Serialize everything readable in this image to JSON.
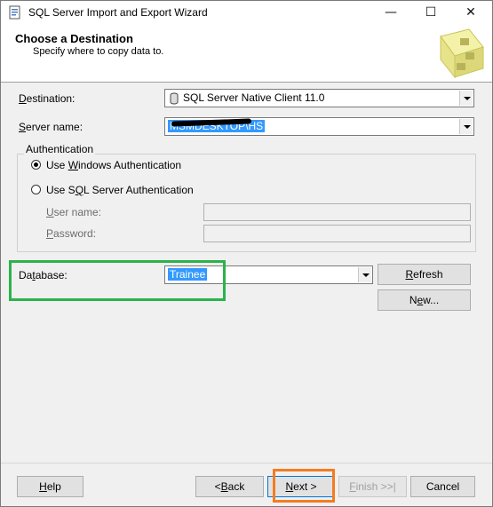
{
  "window": {
    "title": "SQL Server Import and Export Wizard",
    "controls": {
      "minimize": "—",
      "maximize": "☐",
      "close": "✕"
    }
  },
  "header": {
    "title": "Choose a Destination",
    "subtitle": "Specify where to copy data to."
  },
  "form": {
    "destination": {
      "label_pre": "",
      "label_u": "D",
      "label_post": "estination:",
      "value": "SQL Server Native Client 11.0"
    },
    "server_name": {
      "label_pre": "",
      "label_u": "S",
      "label_post": "erver name:",
      "value": "MSMDESKTOP\\HS"
    },
    "authentication": {
      "title": "Authentication",
      "windows": {
        "label_pre": "Use ",
        "label_u": "W",
        "label_post": "indows Authentication",
        "selected": true
      },
      "sql": {
        "label_pre": "Use S",
        "label_u": "Q",
        "label_post": "L Server Authentication",
        "selected": false
      },
      "user_name": {
        "label_pre": "",
        "label_u": "U",
        "label_post": "ser name:",
        "value": ""
      },
      "password": {
        "label_pre": "",
        "label_u": "P",
        "label_post": "assword:",
        "value": ""
      }
    },
    "database": {
      "label_pre": "Da",
      "label_u": "t",
      "label_post": "abase:",
      "value": "Trainee"
    },
    "refresh_button": {
      "label_pre": "",
      "label_u": "R",
      "label_post": "efresh"
    },
    "new_button": {
      "label_pre": "N",
      "label_u": "e",
      "label_post": "w..."
    }
  },
  "footer": {
    "help": {
      "label_pre": "",
      "label_u": "H",
      "label_post": "elp"
    },
    "back": {
      "label_pre": "< ",
      "label_u": "B",
      "label_post": "ack"
    },
    "next": {
      "label_pre": "",
      "label_u": "N",
      "label_post": "ext >"
    },
    "finish": {
      "label_pre": "",
      "label_u": "F",
      "label_post": "inish >>|"
    },
    "cancel": {
      "label": "Cancel"
    }
  },
  "colors": {
    "highlight_green": "#2bb34a",
    "highlight_orange": "#f47c20",
    "selection": "#3399ff"
  },
  "icons": [
    "wizard-app-icon",
    "database-icon",
    "header-wizard-graphic"
  ]
}
